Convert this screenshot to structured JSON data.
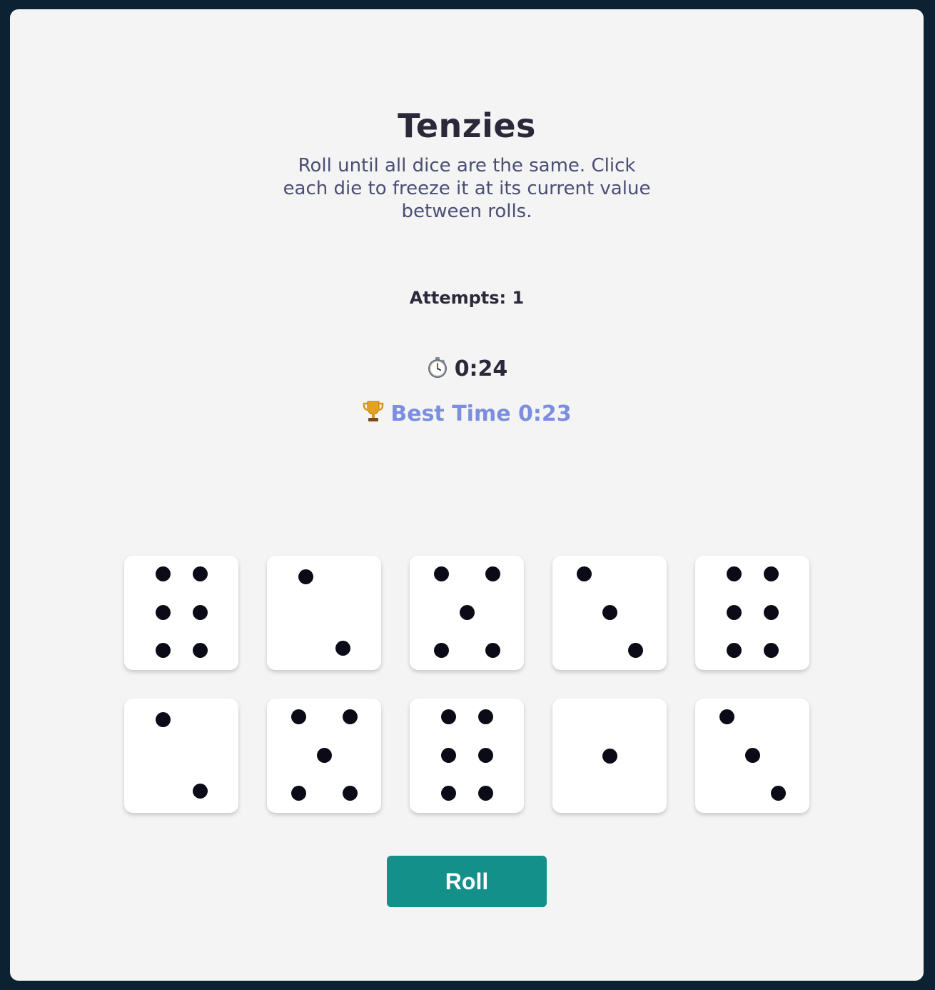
{
  "app": {
    "title": "Tenzies",
    "instructions": "Roll until all dice are the same. Click each die to freeze it at its current value between rolls."
  },
  "stats": {
    "attempts_text": "Attempts: 1",
    "timer_icon": "stopwatch-icon",
    "timer_text": "0:24",
    "best_icon": "trophy-icon",
    "best_text": "Best Time 0:23"
  },
  "dice": [
    {
      "value": 6,
      "held": false
    },
    {
      "value": 2,
      "held": false
    },
    {
      "value": 5,
      "held": false
    },
    {
      "value": 3,
      "held": false
    },
    {
      "value": 6,
      "held": false
    },
    {
      "value": 2,
      "held": false
    },
    {
      "value": 5,
      "held": false
    },
    {
      "value": 6,
      "held": false
    },
    {
      "value": 1,
      "held": false
    },
    {
      "value": 3,
      "held": false
    }
  ],
  "controls": {
    "roll_label": "Roll"
  },
  "colors": {
    "background": "#0c2233",
    "card": "#f4f4f4",
    "accent": "#14908a",
    "best_time": "#7b8ee0",
    "pip": "#0b0b18"
  }
}
